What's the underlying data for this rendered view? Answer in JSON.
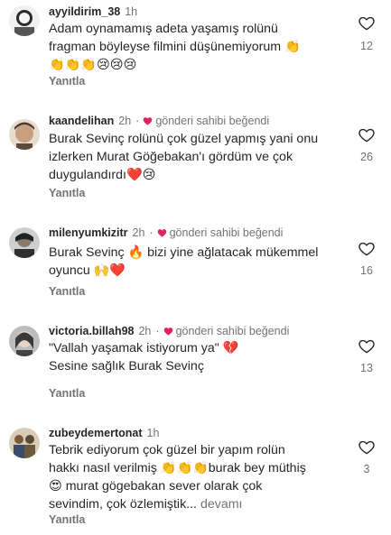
{
  "comments": [
    {
      "username": "ayyildirim_38",
      "time": "1h",
      "liked_by_author": false,
      "liked_label": "",
      "text": "Adam oynamamış adeta yaşamış rolünü\nfragman böyleyse filmini düşünemiyorum 👏\n👏👏👏😢😢😢",
      "more": "",
      "reply_label": "Yanıtla",
      "like_count": "12",
      "avatar_colors": [
        "#6b6b6b",
        "#e8e8e8"
      ]
    },
    {
      "username": "kaandelihan",
      "time": "2h",
      "liked_by_author": true,
      "liked_label": "gönderi sahibi beğendi",
      "text": "Burak Sevinç rolünü çok güzel yapmış yani onu\nizlerken Murat Göğebakan'ı gördüm ve çok\nduygulandırdı❤️😢",
      "more": "",
      "reply_label": "Yanıtla",
      "like_count": "26",
      "avatar_colors": [
        "#c9a07e",
        "#5a4a3a"
      ]
    },
    {
      "username": "milenyumkizitr",
      "time": "2h",
      "liked_by_author": true,
      "liked_label": "gönderi sahibi beğendi",
      "text": "Burak Sevinç 🔥 bizi yine ağlatacak mükemmel\noyuncu 🙌❤️",
      "more": "",
      "reply_label": "Yanıtla",
      "like_count": "16",
      "avatar_colors": [
        "#3a3a3a",
        "#a0a0a0"
      ]
    },
    {
      "username": "victoria.billah98",
      "time": "2h",
      "liked_by_author": true,
      "liked_label": "gönderi sahibi beğendi",
      "text": "\"Vallah yaşamak istiyorum ya\" 💔\nSesine sağlık Burak Sevinç",
      "more": "",
      "reply_label": "Yanıtla",
      "like_count": "13",
      "avatar_colors": [
        "#4a4a4a",
        "#d6d6d6"
      ]
    },
    {
      "username": "zubeydemertonat",
      "time": "1h",
      "liked_by_author": false,
      "liked_label": "",
      "text": "Tebrik ediyorum çok güzel bir yapım rolün\nhakkı nasıl verilmiş 👏👏👏burak bey müthiş\n😍 murat gögebakan sever olarak çok\nsevindim, çok özlemiştik...",
      "more": "devamı",
      "reply_label": "Yanıtla",
      "like_count": "3",
      "avatar_colors": [
        "#6b5a3a",
        "#3c4b6b"
      ]
    }
  ]
}
